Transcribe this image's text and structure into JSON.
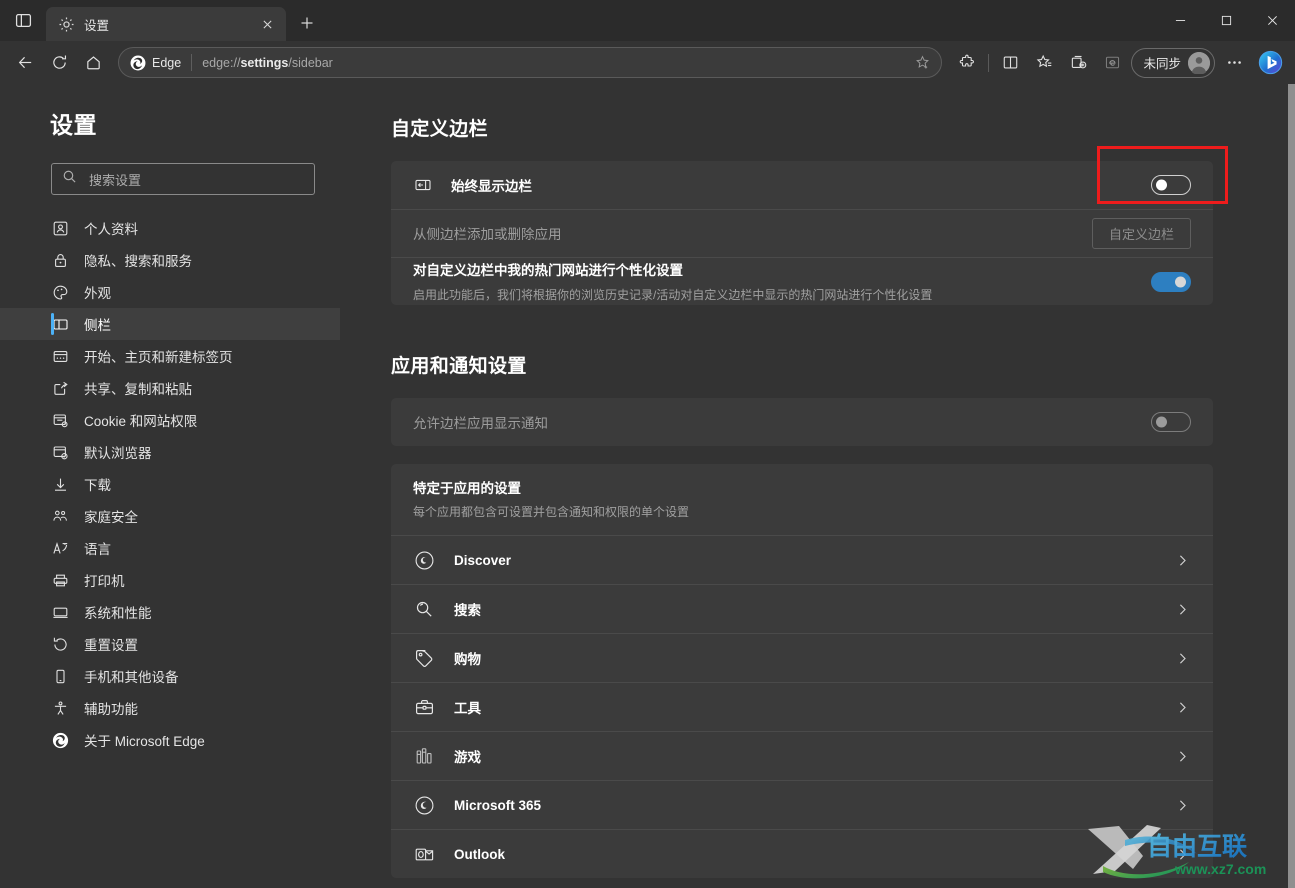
{
  "window": {
    "tab_search_icon": "tab-search-icon",
    "minimize_label": "—",
    "maximize_label": "□",
    "close_label": "✕"
  },
  "tab": {
    "title": "设置",
    "favicon": "gear-icon",
    "close_icon": "close-icon",
    "new_tab_icon": "plus-icon"
  },
  "toolbar": {
    "back_icon": "back-arrow-icon",
    "refresh_icon": "refresh-icon",
    "home_icon": "home-icon",
    "edge_badge": "Edge",
    "url_prefix": "edge://",
    "url_bold": "settings",
    "url_suffix": "/sidebar",
    "favorite_icon": "add-favorite-star-icon",
    "extensions_icon": "extensions-puzzle-icon",
    "split_screen_icon": "split-screen-icon",
    "favorites_icon": "favorites-star-icon",
    "collections_icon": "collections-icon",
    "ie_mode_icon": "ie-mode-icon",
    "profile_label": "未同步",
    "avatar_icon": "avatar-icon",
    "more_icon": "more-ellipsis-icon",
    "bing_icon": "bing-copilot-icon"
  },
  "sidebar": {
    "title": "设置",
    "search": {
      "placeholder": "搜索设置",
      "icon": "search-icon"
    },
    "items": [
      {
        "label": "个人资料",
        "icon": "profile-icon",
        "active": false
      },
      {
        "label": "隐私、搜索和服务",
        "icon": "lock-icon",
        "active": false
      },
      {
        "label": "外观",
        "icon": "palette-icon",
        "active": false
      },
      {
        "label": "侧栏",
        "icon": "sidebar-panel-icon",
        "active": true
      },
      {
        "label": "开始、主页和新建标签页",
        "icon": "start-page-icon",
        "active": false
      },
      {
        "label": "共享、复制和粘贴",
        "icon": "share-icon",
        "active": false
      },
      {
        "label": "Cookie 和网站权限",
        "icon": "cookie-permissions-icon",
        "active": false
      },
      {
        "label": "默认浏览器",
        "icon": "default-browser-icon",
        "active": false
      },
      {
        "label": "下载",
        "icon": "download-icon",
        "active": false
      },
      {
        "label": "家庭安全",
        "icon": "family-safety-icon",
        "active": false
      },
      {
        "label": "语言",
        "icon": "language-icon",
        "active": false
      },
      {
        "label": "打印机",
        "icon": "printer-icon",
        "active": false
      },
      {
        "label": "系统和性能",
        "icon": "system-performance-icon",
        "active": false
      },
      {
        "label": "重置设置",
        "icon": "reset-icon",
        "active": false
      },
      {
        "label": "手机和其他设备",
        "icon": "phone-devices-icon",
        "active": false
      },
      {
        "label": "辅助功能",
        "icon": "accessibility-icon",
        "active": false
      },
      {
        "label": "关于 Microsoft Edge",
        "icon": "edge-logo-icon",
        "active": false
      }
    ]
  },
  "main": {
    "section1": {
      "heading": "自定义边栏",
      "row_always_show": {
        "label": "始终显示边栏",
        "icon": "sidebar-panel-icon",
        "toggle_state": "off"
      },
      "row_add_remove": {
        "label": "从侧边栏添加或删除应用",
        "button_label": "自定义边栏",
        "button_disabled": true
      },
      "row_personalize": {
        "label": "对自定义边栏中我的热门网站进行个性化设置",
        "description": "启用此功能后，我们将根据你的浏览历史记录/活动对自定义边栏中显示的热门网站进行个性化设置",
        "toggle_state": "on"
      }
    },
    "section2": {
      "heading": "应用和通知设置",
      "row_allow_notifications": {
        "label": "允许边栏应用显示通知",
        "toggle_state": "off"
      },
      "app_settings_header": {
        "title": "特定于应用的设置",
        "description": "每个应用都包含可设置并包含通知和权限的单个设置"
      },
      "apps": [
        {
          "name": "Discover",
          "icon": "discover-icon"
        },
        {
          "name": "搜索",
          "icon": "search-app-icon"
        },
        {
          "name": "购物",
          "icon": "shopping-tag-icon"
        },
        {
          "name": "工具",
          "icon": "tools-briefcase-icon"
        },
        {
          "name": "游戏",
          "icon": "games-icon"
        },
        {
          "name": "Microsoft 365",
          "icon": "microsoft365-icon"
        },
        {
          "name": "Outlook",
          "icon": "outlook-icon"
        }
      ],
      "chevron_icon": "chevron-right-icon"
    }
  },
  "annotation": {
    "type": "red-highlight-box",
    "target": "始终显示边栏 toggle"
  },
  "watermark": {
    "text_main": "自由互联",
    "text_url": "www.xz7.com",
    "logo": "X"
  },
  "colors": {
    "page_bg": "#333333",
    "card_bg": "#3b3b3b",
    "titlebar_bg": "#2b2b2b",
    "accent_blue": "#4cb2f7",
    "toggle_on": "#2d7fc1",
    "annotation_red": "#ee1c1c",
    "text_primary": "#ffffff",
    "text_secondary": "#a0a0a0"
  }
}
